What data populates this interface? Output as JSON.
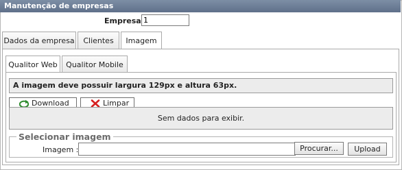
{
  "window": {
    "title": "Manutenção de empresas"
  },
  "empresa": {
    "label": "Empresa :",
    "value": "1"
  },
  "tabs": [
    {
      "label": "Dados da empresa",
      "active": false
    },
    {
      "label": "Clientes",
      "active": false
    },
    {
      "label": "Imagem",
      "active": true
    }
  ],
  "subtabs": [
    {
      "label": "Qualitor Web",
      "active": true
    },
    {
      "label": "Qualitor Mobile",
      "active": false
    }
  ],
  "info": {
    "message": "A imagem deve possuir largura 129px e altura 63px."
  },
  "toolbar": {
    "download_label": "Download",
    "download_icon": "download-icon",
    "clear_label": "Limpar",
    "clear_icon": "clear-x-icon"
  },
  "grid": {
    "empty_message": "Sem dados para exibir."
  },
  "upload": {
    "legend": "Selecionar imagem",
    "label": "Imagem :",
    "value": "",
    "browse_label": "Procurar...",
    "upload_label": "Upload"
  },
  "colors": {
    "titlebar": "#6b7c95",
    "panel_bg": "#ececec",
    "download_icon": "#2e8b2e",
    "clear_icon": "#d62020"
  }
}
